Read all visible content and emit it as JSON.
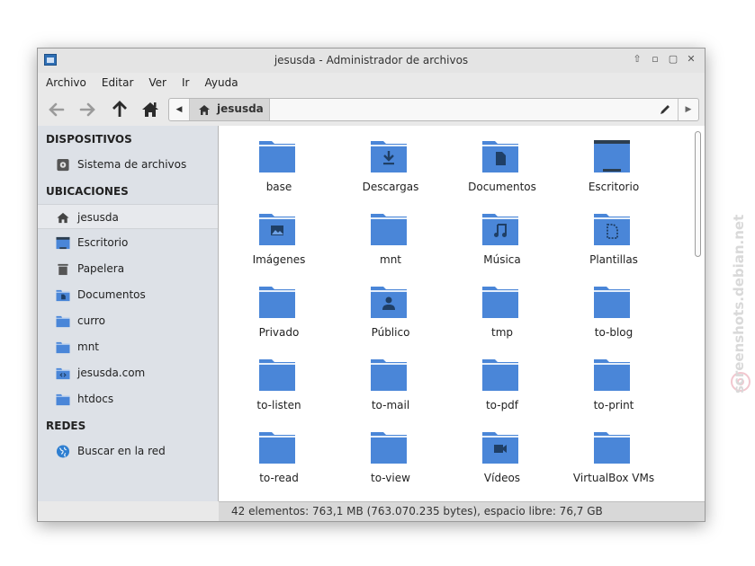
{
  "window": {
    "title": "jesusda - Administrador de archivos"
  },
  "menu": [
    "Archivo",
    "Editar",
    "Ver",
    "Ir",
    "Ayuda"
  ],
  "pathbar": {
    "current": "jesusda"
  },
  "sidebar": {
    "devices_header": "DISPOSITIVOS",
    "devices": [
      {
        "label": "Sistema de archivos",
        "icon": "drive-icon"
      }
    ],
    "places_header": "UBICACIONES",
    "places": [
      {
        "label": "jesusda",
        "icon": "home-icon"
      },
      {
        "label": "Escritorio",
        "icon": "desktop-icon"
      },
      {
        "label": "Papelera",
        "icon": "trash-icon"
      },
      {
        "label": "Documentos",
        "icon": "folder-documents-icon"
      },
      {
        "label": "curro",
        "icon": "folder-icon"
      },
      {
        "label": "mnt",
        "icon": "folder-icon"
      },
      {
        "label": "jesusda.com",
        "icon": "folder-code-icon"
      },
      {
        "label": "htdocs",
        "icon": "folder-icon"
      }
    ],
    "network_header": "REDES",
    "network": [
      {
        "label": "Buscar en la red",
        "icon": "globe-icon"
      }
    ]
  },
  "files": [
    {
      "label": "base",
      "glyph": ""
    },
    {
      "label": "Descargas",
      "glyph": "download"
    },
    {
      "label": "Documentos",
      "glyph": "document"
    },
    {
      "label": "Escritorio",
      "glyph": "desktop"
    },
    {
      "label": "Imágenes",
      "glyph": "image"
    },
    {
      "label": "mnt",
      "glyph": ""
    },
    {
      "label": "Música",
      "glyph": "music"
    },
    {
      "label": "Plantillas",
      "glyph": "template"
    },
    {
      "label": "Privado",
      "glyph": ""
    },
    {
      "label": "Público",
      "glyph": "user"
    },
    {
      "label": "tmp",
      "glyph": ""
    },
    {
      "label": "to-blog",
      "glyph": ""
    },
    {
      "label": "to-listen",
      "glyph": ""
    },
    {
      "label": "to-mail",
      "glyph": ""
    },
    {
      "label": "to-pdf",
      "glyph": ""
    },
    {
      "label": "to-print",
      "glyph": ""
    },
    {
      "label": "to-read",
      "glyph": ""
    },
    {
      "label": "to-view",
      "glyph": ""
    },
    {
      "label": "Vídeos",
      "glyph": "video"
    },
    {
      "label": "VirtualBox VMs",
      "glyph": ""
    }
  ],
  "status": "42 elementos: 763,1 MB (763.070.235 bytes), espacio libre: 76,7 GB",
  "watermark": "screenshots.debian.net",
  "colors": {
    "folder": "#4a86d8",
    "folder_light": "#6fa2e6",
    "glyph": "#1f3f66"
  }
}
